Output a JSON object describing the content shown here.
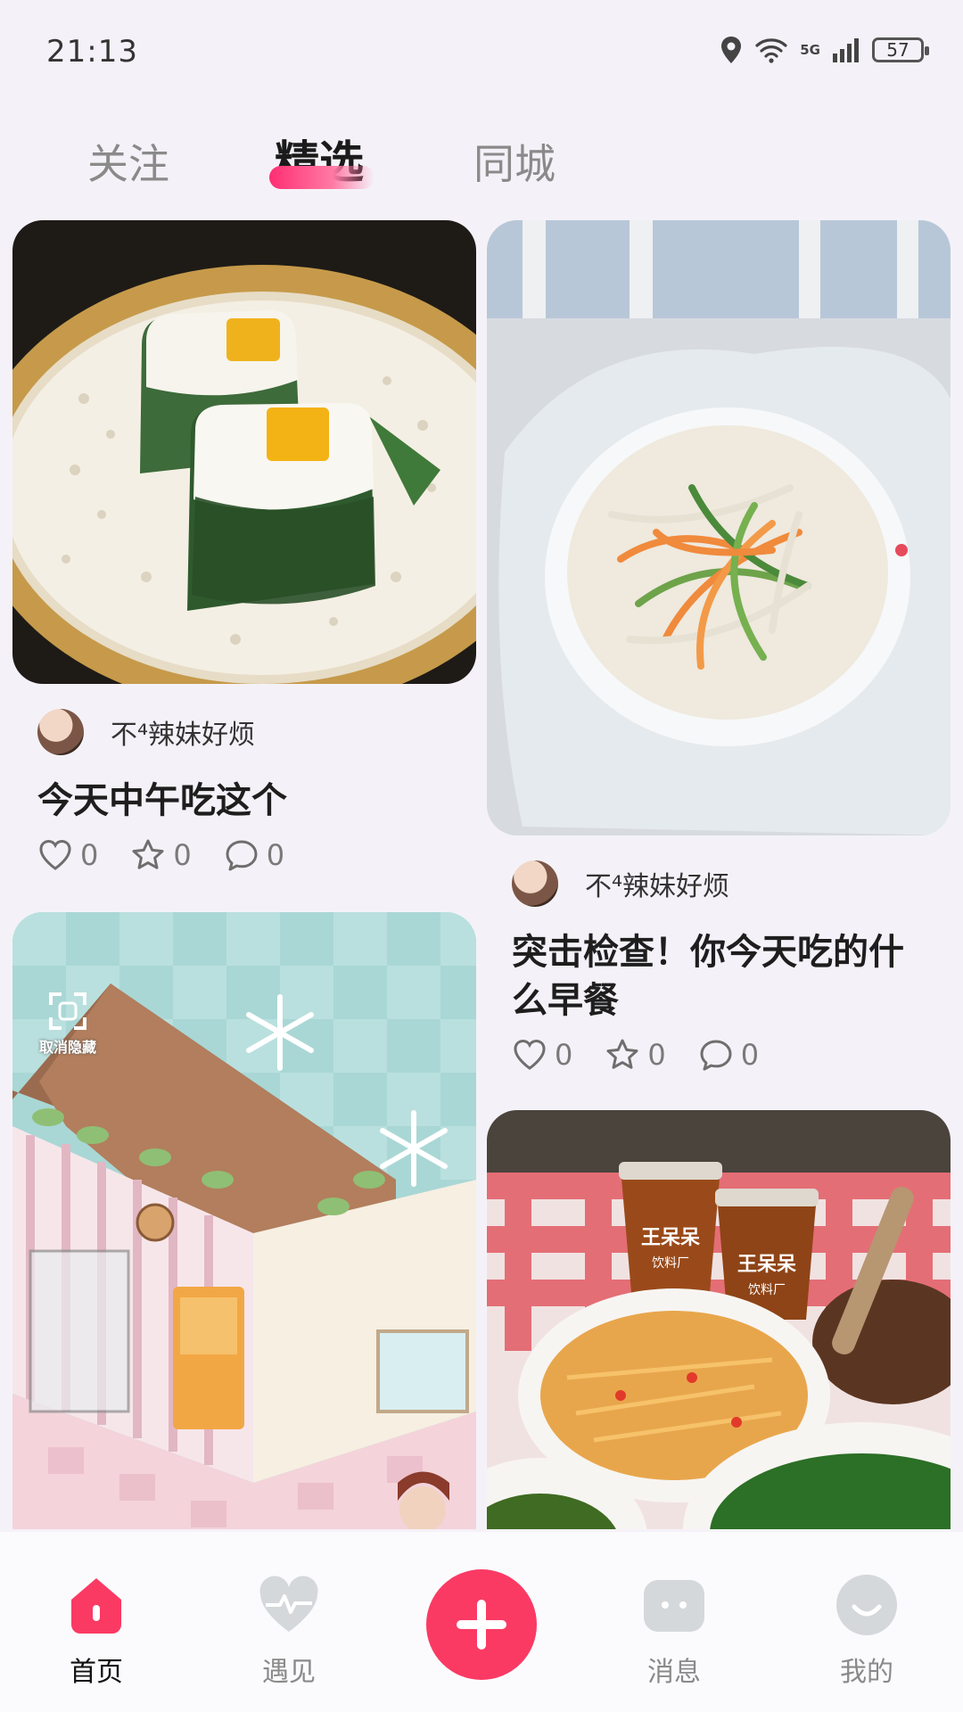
{
  "status": {
    "time": "21:13",
    "battery": "57",
    "network": "5G"
  },
  "tabs": [
    {
      "label": "关注"
    },
    {
      "label": "精选"
    },
    {
      "label": "同城"
    }
  ],
  "posts": [
    {
      "author": "不⁴辣妹好烦",
      "title": "今天中午吃这个",
      "likes": "0",
      "favorites": "0",
      "comments": "0"
    },
    {
      "author": "不⁴辣妹好烦",
      "title": "突击检查！你今天吃的什么早餐",
      "likes": "0",
      "favorites": "0",
      "comments": "0"
    }
  ],
  "hidden_overlay": {
    "label": "取消隐藏"
  },
  "cup_label": {
    "brand": "王呆呆",
    "sub": "饮料厂"
  },
  "nav": [
    {
      "label": "首页"
    },
    {
      "label": "遇见"
    },
    {
      "label": "消息"
    },
    {
      "label": "我的"
    }
  ],
  "colors": {
    "accent": "#fb3a64",
    "tab_underline": "#ff2e73",
    "background": "#f4f2f8"
  }
}
